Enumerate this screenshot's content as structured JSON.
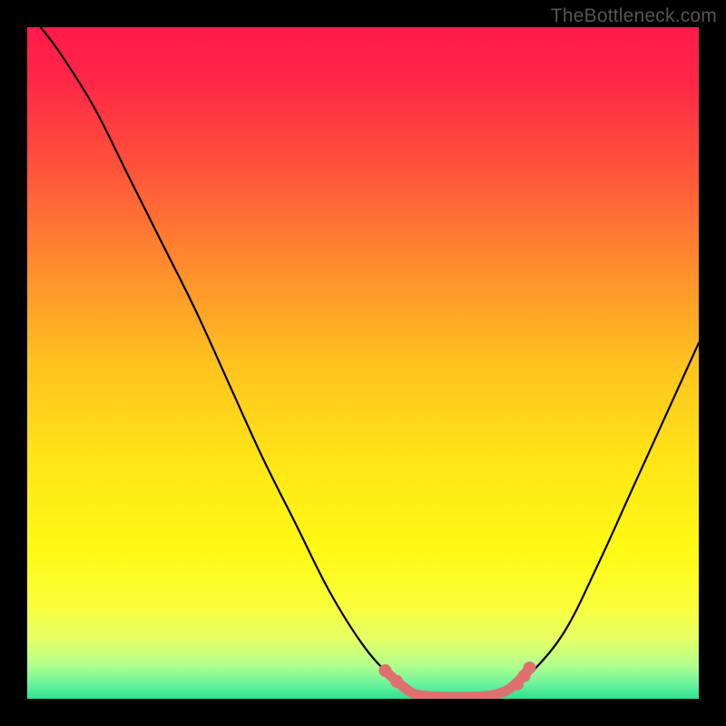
{
  "watermark": "TheBottleneck.com",
  "gradient_stops": [
    {
      "offset": 0,
      "color": "#ff1a4b"
    },
    {
      "offset": 0.08,
      "color": "#ff2746"
    },
    {
      "offset": 0.2,
      "color": "#ff4f3b"
    },
    {
      "offset": 0.35,
      "color": "#ff8a2e"
    },
    {
      "offset": 0.5,
      "color": "#ffc21f"
    },
    {
      "offset": 0.65,
      "color": "#ffe617"
    },
    {
      "offset": 0.78,
      "color": "#fff914"
    },
    {
      "offset": 0.86,
      "color": "#faff3a"
    },
    {
      "offset": 0.91,
      "color": "#e6ff66"
    },
    {
      "offset": 0.95,
      "color": "#b3ff8c"
    },
    {
      "offset": 0.98,
      "color": "#66f29f"
    },
    {
      "offset": 1.0,
      "color": "#2ee08f"
    }
  ],
  "chart_data": {
    "type": "line",
    "title": "",
    "xlabel": "",
    "ylabel": "",
    "xlim": [
      0,
      100
    ],
    "ylim": [
      0,
      100
    ],
    "series": [
      {
        "name": "curve",
        "color": "#000000",
        "points": [
          {
            "x": 2,
            "y": 100
          },
          {
            "x": 5,
            "y": 96
          },
          {
            "x": 10,
            "y": 88
          },
          {
            "x": 15,
            "y": 78
          },
          {
            "x": 20,
            "y": 68
          },
          {
            "x": 25,
            "y": 58
          },
          {
            "x": 30,
            "y": 47
          },
          {
            "x": 35,
            "y": 36
          },
          {
            "x": 40,
            "y": 26
          },
          {
            "x": 45,
            "y": 16
          },
          {
            "x": 50,
            "y": 8
          },
          {
            "x": 54,
            "y": 3.5
          },
          {
            "x": 57,
            "y": 1.2
          },
          {
            "x": 60,
            "y": 0.5
          },
          {
            "x": 63,
            "y": 0.3
          },
          {
            "x": 66,
            "y": 0.3
          },
          {
            "x": 69,
            "y": 0.5
          },
          {
            "x": 72,
            "y": 1.3
          },
          {
            "x": 75,
            "y": 3.8
          },
          {
            "x": 80,
            "y": 10
          },
          {
            "x": 85,
            "y": 20
          },
          {
            "x": 90,
            "y": 31
          },
          {
            "x": 95,
            "y": 42
          },
          {
            "x": 100,
            "y": 53
          }
        ]
      },
      {
        "name": "highlight",
        "color": "#e07070",
        "points": [
          {
            "x": 53.5,
            "y": 4.0
          },
          {
            "x": 55.5,
            "y": 2.2
          },
          {
            "x": 57.5,
            "y": 0.8
          },
          {
            "x": 60,
            "y": 0.4
          },
          {
            "x": 63,
            "y": 0.3
          },
          {
            "x": 66,
            "y": 0.3
          },
          {
            "x": 69,
            "y": 0.5
          },
          {
            "x": 71.5,
            "y": 1.3
          },
          {
            "x": 73.5,
            "y": 3.0
          },
          {
            "x": 74.5,
            "y": 4.2
          }
        ],
        "dots": [
          {
            "x": 53.3,
            "y": 4.2
          },
          {
            "x": 55.0,
            "y": 2.6
          },
          {
            "x": 73.0,
            "y": 2.2
          },
          {
            "x": 74.0,
            "y": 3.4
          },
          {
            "x": 74.8,
            "y": 4.6
          }
        ]
      }
    ]
  }
}
